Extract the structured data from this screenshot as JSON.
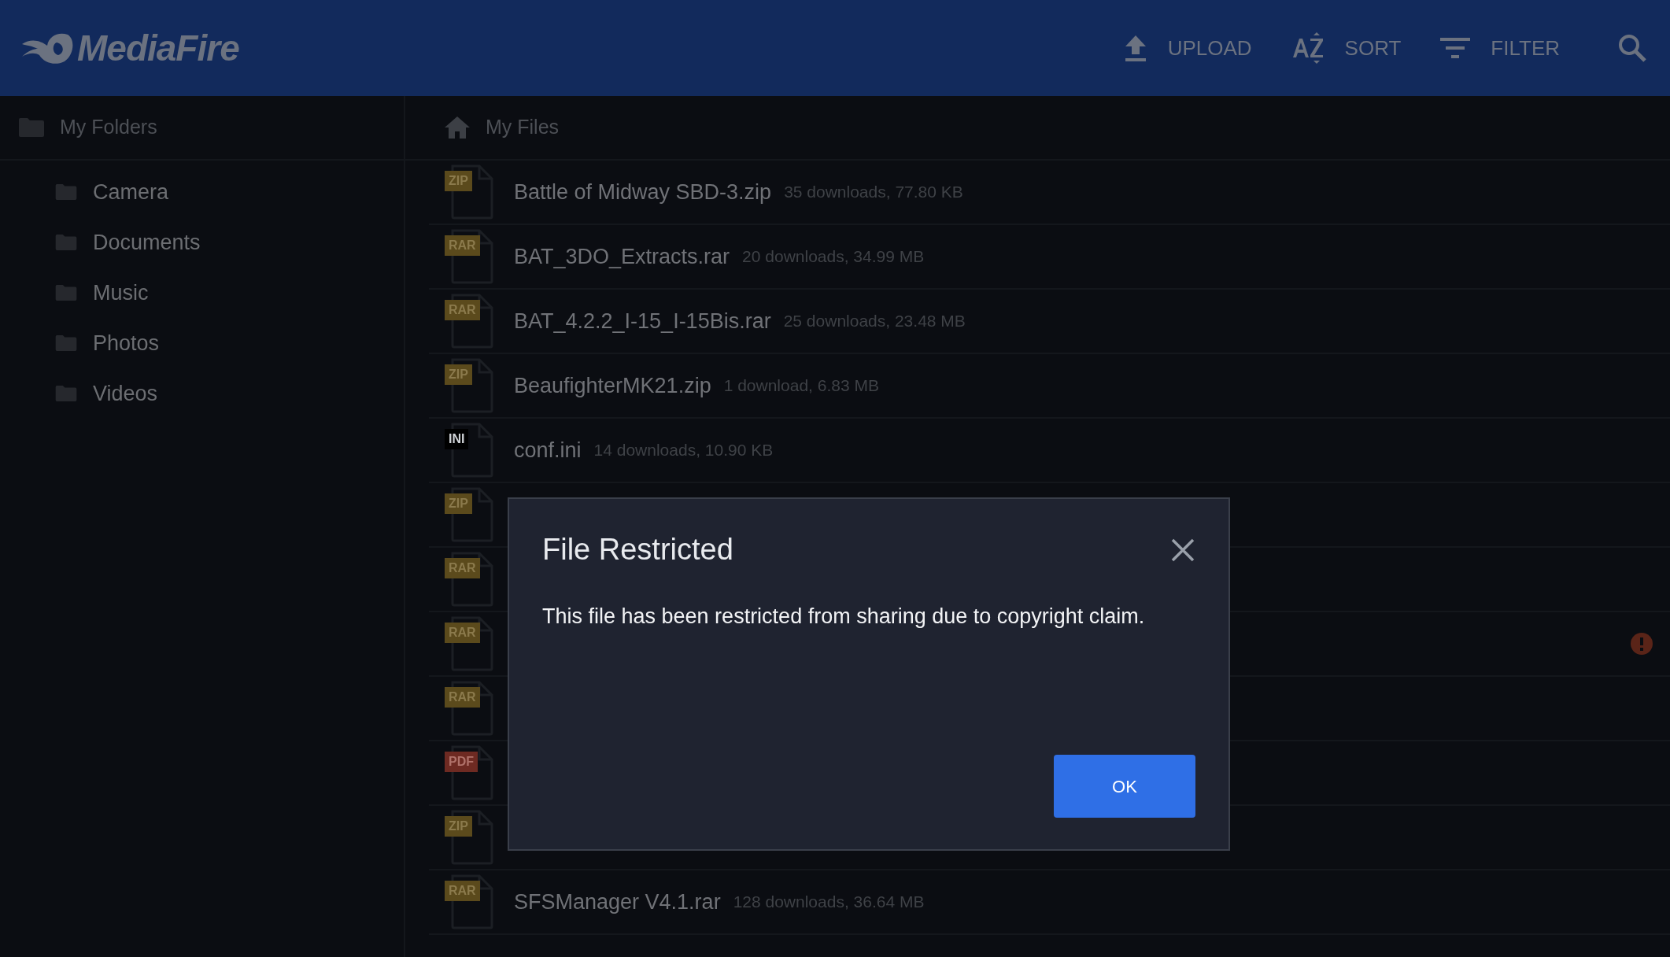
{
  "header": {
    "logo": "MediaFire",
    "actions": [
      {
        "kind": "upload",
        "label": "UPLOAD"
      },
      {
        "kind": "sort",
        "label": "SORT"
      },
      {
        "kind": "filter",
        "label": "FILTER"
      }
    ]
  },
  "sidebar": {
    "title": "My Folders",
    "items": [
      "Camera",
      "Documents",
      "Music",
      "Photos",
      "Videos"
    ]
  },
  "breadcrumb": "My Files",
  "files": [
    {
      "type": "ZIP",
      "color": "#5b4a1c",
      "name": "Battle of Midway SBD-3.zip",
      "meta": "35 downloads, 77.80 KB",
      "flagged": false
    },
    {
      "type": "RAR",
      "color": "#5b4a1c",
      "name": "BAT_3DO_Extracts.rar",
      "meta": "20 downloads, 34.99 MB",
      "flagged": false
    },
    {
      "type": "RAR",
      "color": "#5b4a1c",
      "name": "BAT_4.2.2_I-15_I-15Bis.rar",
      "meta": "25 downloads, 23.48 MB",
      "flagged": false
    },
    {
      "type": "ZIP",
      "color": "#5b4a1c",
      "name": "BeaufighterMK21.zip",
      "meta": "1 download, 6.83 MB",
      "flagged": false
    },
    {
      "type": "INI",
      "color": "#000000",
      "name": "conf.ini",
      "meta": "14 downloads, 10.90 KB",
      "flagged": false
    },
    {
      "type": "ZIP",
      "color": "#5b4a1c",
      "flagged": false
    },
    {
      "type": "RAR",
      "color": "#5b4a1c",
      "flagged": false
    },
    {
      "type": "RAR",
      "color": "#5b4a1c",
      "flagged": true
    },
    {
      "type": "RAR",
      "color": "#5b4a1c",
      "flagged": false
    },
    {
      "type": "PDF",
      "color": "#6e2a22",
      "flagged": false
    },
    {
      "type": "ZIP",
      "color": "#5b4a1c",
      "flagged": false
    },
    {
      "type": "RAR",
      "color": "#5b4a1c",
      "name": "SFSManager V4.1.rar",
      "meta": "128 downloads, 36.64 MB",
      "flagged": false
    }
  ],
  "dialog": {
    "title": "File Restricted",
    "message": "This file has been restricted from sharing due to copyright claim.",
    "button": "OK"
  }
}
